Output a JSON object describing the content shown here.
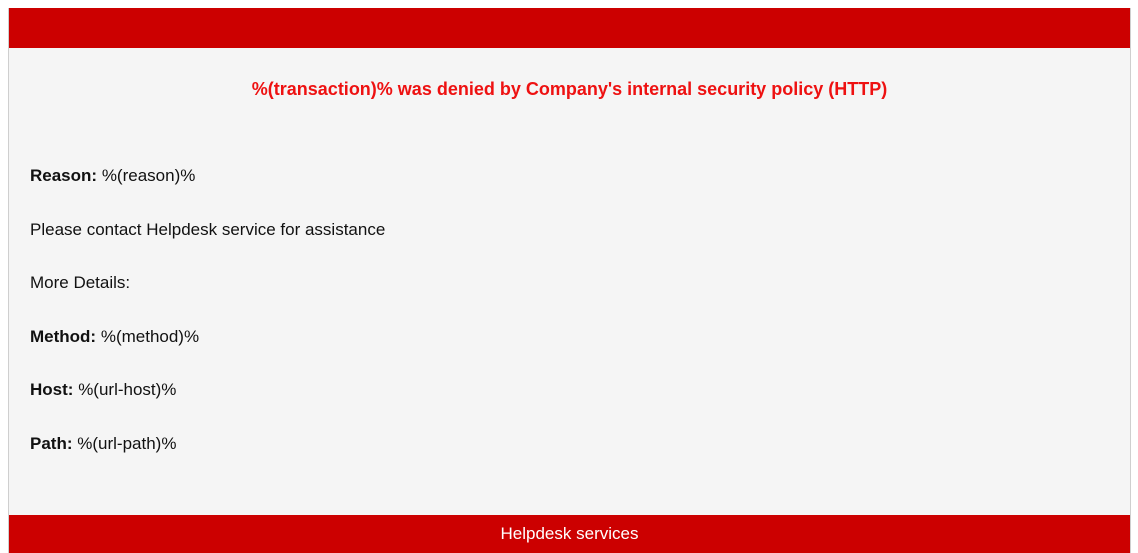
{
  "headline": "%(transaction)% was denied by Company's internal security policy (HTTP)",
  "reason": {
    "label": "Reason:",
    "value": "%(reason)%"
  },
  "contact_text": "Please contact Helpdesk service for assistance",
  "more_details": "More Details:",
  "method": {
    "label": "Method:",
    "value": "%(method)%"
  },
  "host": {
    "label": "Host:",
    "value": "%(url-host)%"
  },
  "path": {
    "label": "Path:",
    "value": "%(url-path)%"
  },
  "footer": {
    "label": "Helpdesk services"
  },
  "colors": {
    "brand_red": "#cc0000",
    "headline_red": "#ee1111",
    "background": "#f5f5f5"
  }
}
